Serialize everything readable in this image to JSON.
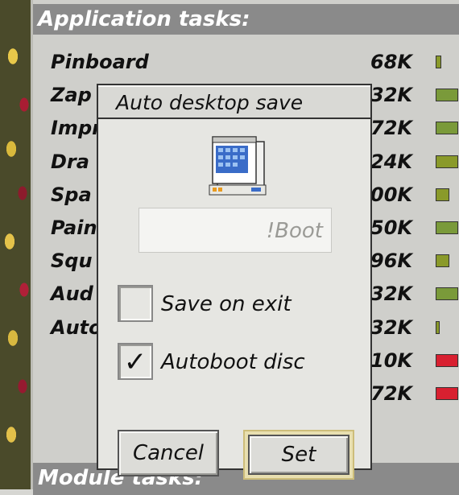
{
  "task_window": {
    "application_header": "Application tasks:",
    "module_header": "Module tasks:",
    "tasks": [
      {
        "name": "Pinboard",
        "memory": "68K",
        "bar_fraction": 0.25,
        "bar_color": "#8a9a2a"
      },
      {
        "name": "Zap",
        "memory": "32K",
        "bar_fraction": 1.0,
        "bar_color": "#7a9a3a"
      },
      {
        "name": "Impr",
        "memory": "72K",
        "bar_fraction": 1.0,
        "bar_color": "#7a9a3a"
      },
      {
        "name": "Dra",
        "memory": "24K",
        "bar_fraction": 1.0,
        "bar_color": "#8a9a2a"
      },
      {
        "name": "Spa",
        "memory": "00K",
        "bar_fraction": 0.6,
        "bar_color": "#8a9a2a"
      },
      {
        "name": "Pain",
        "memory": "50K",
        "bar_fraction": 1.0,
        "bar_color": "#7a9a3a"
      },
      {
        "name": "Squ",
        "memory": "96K",
        "bar_fraction": 0.6,
        "bar_color": "#8a9a2a"
      },
      {
        "name": "Aud",
        "memory": "32K",
        "bar_fraction": 1.0,
        "bar_color": "#7a9a3a"
      },
      {
        "name": "Auto",
        "memory": "32K",
        "bar_fraction": 0.1,
        "bar_color": "#8a9a2a"
      },
      {
        "name": "",
        "memory": "10K",
        "bar_fraction": 1.0,
        "bar_color": "#d82030"
      },
      {
        "name": "",
        "memory": "72K",
        "bar_fraction": 1.0,
        "bar_color": "#d82030"
      }
    ]
  },
  "dialog": {
    "title": "Auto desktop save",
    "path_value": "!Boot",
    "save_on_exit": {
      "label": "Save on exit",
      "checked": false
    },
    "autoboot_disc": {
      "label": "Autoboot disc",
      "checked": true,
      "mark": "✓"
    },
    "cancel_label": "Cancel",
    "set_label": "Set",
    "icon": "desktop-file-icon"
  }
}
